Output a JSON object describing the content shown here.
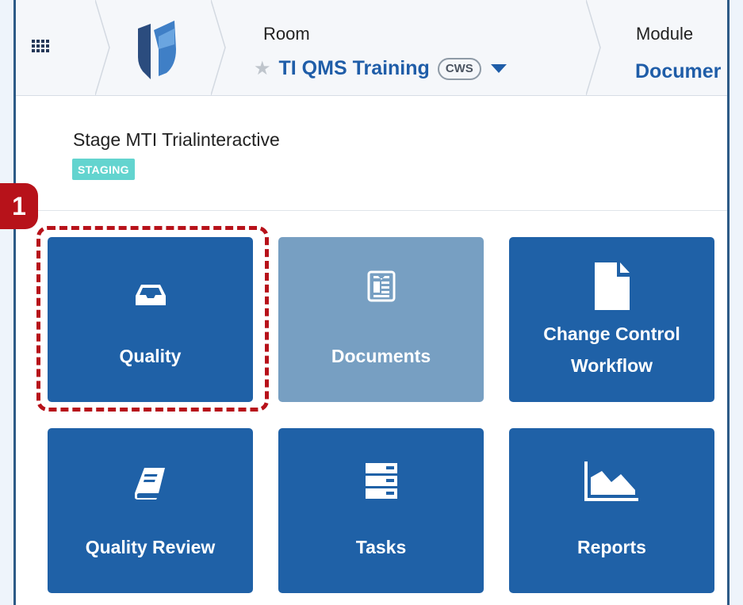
{
  "header": {
    "room_label": "Room",
    "room_name": "TI QMS Training",
    "room_badge": "CWS",
    "module_label": "Module",
    "module_value": "Documer"
  },
  "workspace": {
    "name": "Stage MTI Trialinteractive",
    "environment_badge": "STAGING"
  },
  "tiles": [
    {
      "label": "Quality",
      "icon": "inbox-icon",
      "enabled": true
    },
    {
      "label": "Documents",
      "icon": "document-icon",
      "enabled": false
    },
    {
      "label_line1": "Change Control",
      "label_line2": "Workflow",
      "icon": "file-icon",
      "enabled": true
    },
    {
      "label": "Quality Review",
      "icon": "book-icon",
      "enabled": true
    },
    {
      "label": "Tasks",
      "icon": "server-icon",
      "enabled": true
    },
    {
      "label": "Reports",
      "icon": "area-chart-icon",
      "enabled": true
    }
  ],
  "annotation": {
    "step_number": "1"
  },
  "colors": {
    "tile": "#1f61a7",
    "tile_disabled": "#779fc2",
    "accent_blue": "#1f5da8",
    "staging": "#63d4cf",
    "highlight": "#b7121a"
  }
}
